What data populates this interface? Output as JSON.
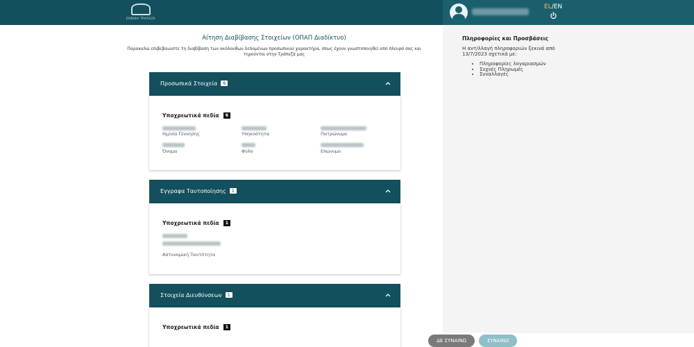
{
  "header": {
    "logo_text": "ΕΘΝΙΚΗ ΤΡΑΠΕΖΑ",
    "lang_el": "EL",
    "lang_sep": "/",
    "lang_en": "EN"
  },
  "main": {
    "title": "Αίτηση Διαβίβασης Στοιχείων (ΟΠΑΠ Διαδίκτυο)",
    "subtitle": "Παρακαλώ επιβεβαιώστε τη διαβίβαση των ακόλουθων δεδομένων προσωπικού χαρακτήρα, όπως έχουν γνωστοποιηθεί από πλευρά σας και τηρούνται στην Τράπεζά μας"
  },
  "cards": [
    {
      "title": "Προσωπικά Στοιχεία",
      "count": "6",
      "required_label": "Υποχρεωτικά πεδία",
      "required_count": "6",
      "fields": [
        "Ημ/νία Γέννησης",
        "Υπηκοότητα",
        "Πατρώνυμο",
        "Όνομα",
        "Φύλο",
        "Επώνυμο"
      ]
    },
    {
      "title": "Εγγραφα Ταυτοποίησης",
      "count": "1",
      "required_label": "Υποχρεωτικά πεδία",
      "required_count": "1",
      "fields": [
        "Αστυνομική Ταυτότητα"
      ]
    },
    {
      "title": "Στοιχεία Διευθύνσεων",
      "count": "1",
      "required_label": "Υποχρεωτικά πεδία",
      "required_count": "1",
      "fields": []
    }
  ],
  "info": {
    "title": "Πληροφορίες και Προσβάσεις",
    "text": "Η αντ/λλαγή πληροφοριών ξεκινά από 13/7/2023 σχετικά με:",
    "items": [
      "Πληροφορίες λογαριασμών",
      "Συχνές Πληρωμές",
      "Συναλλαγές"
    ]
  },
  "buttons": {
    "decline": "ΔΕ ΣΥΝΑΙΝΩ",
    "accept": "ΣΥΝΑΙΝΩ"
  },
  "colors": {
    "primary": "#134f5c",
    "header_panel": "#1b5f6d",
    "lang_active": "#f0c24b",
    "decline_button": "#7a7a7a",
    "accept_button": "#8fbfc9"
  },
  "icons": {
    "avatar": "user-avatar-icon",
    "power": "power-icon",
    "chevron": "chevron-up-icon"
  }
}
